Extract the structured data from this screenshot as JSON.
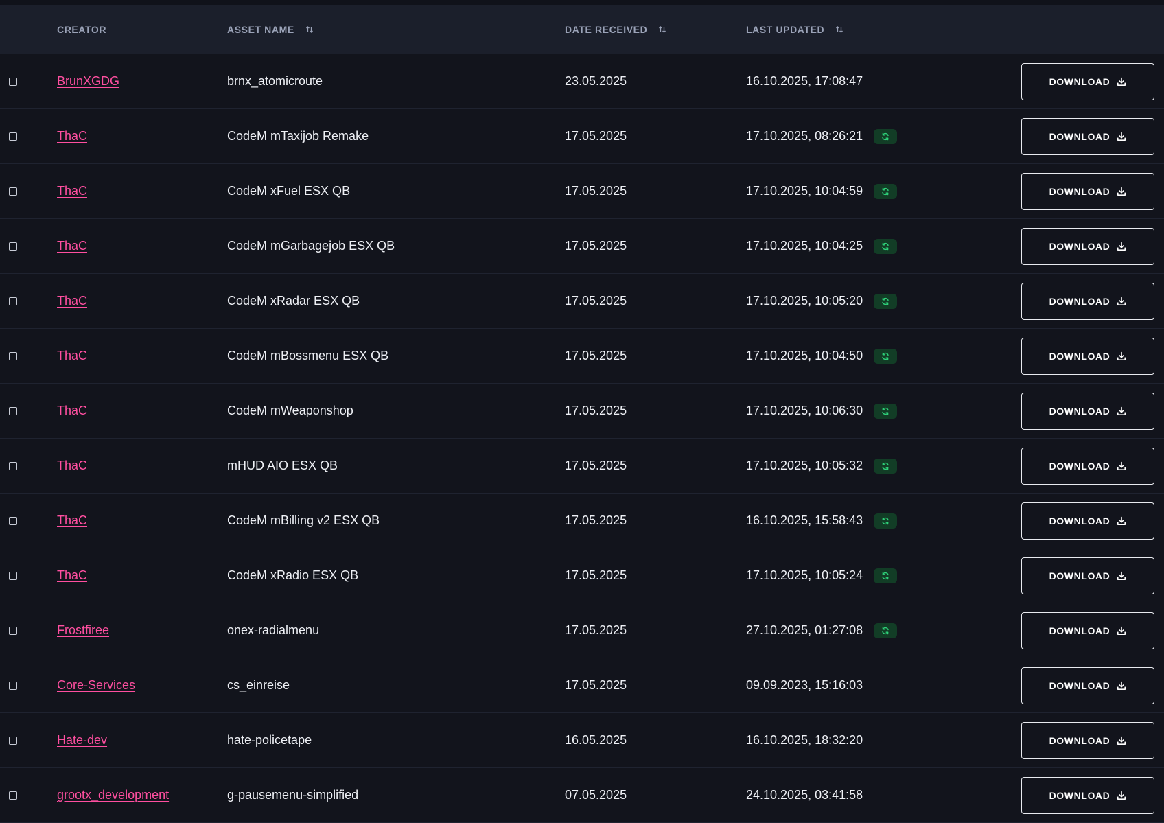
{
  "table": {
    "columns": {
      "creator": "CREATOR",
      "asset_name": "ASSET NAME",
      "date_received": "DATE RECEIVED",
      "last_updated": "LAST UPDATED"
    },
    "sortable_columns": [
      "asset_name",
      "date_received",
      "last_updated"
    ],
    "download_label": "DOWNLOAD",
    "colors": {
      "creator_link": "#ff4fa0",
      "update_badge_bg": "#123d26",
      "update_icon": "#2fd27a",
      "header_bg": "#1b1f2b",
      "row_bg": "#12141c"
    },
    "rows": [
      {
        "creator": "BrunXGDG",
        "asset": "brnx_atomicroute",
        "date": "23.05.2025",
        "updated": "16.10.2025, 17:08:47",
        "updated_icon": false
      },
      {
        "creator": "ThaC",
        "asset": "CodeM mTaxijob Remake",
        "date": "17.05.2025",
        "updated": "17.10.2025, 08:26:21",
        "updated_icon": true
      },
      {
        "creator": "ThaC",
        "asset": "CodeM xFuel ESX QB",
        "date": "17.05.2025",
        "updated": "17.10.2025, 10:04:59",
        "updated_icon": true
      },
      {
        "creator": "ThaC",
        "asset": "CodeM mGarbagejob ESX QB",
        "date": "17.05.2025",
        "updated": "17.10.2025, 10:04:25",
        "updated_icon": true
      },
      {
        "creator": "ThaC",
        "asset": "CodeM xRadar ESX QB",
        "date": "17.05.2025",
        "updated": "17.10.2025, 10:05:20",
        "updated_icon": true
      },
      {
        "creator": "ThaC",
        "asset": "CodeM mBossmenu ESX QB",
        "date": "17.05.2025",
        "updated": "17.10.2025, 10:04:50",
        "updated_icon": true
      },
      {
        "creator": "ThaC",
        "asset": "CodeM mWeaponshop",
        "date": "17.05.2025",
        "updated": "17.10.2025, 10:06:30",
        "updated_icon": true
      },
      {
        "creator": "ThaC",
        "asset": "mHUD AIO ESX QB",
        "date": "17.05.2025",
        "updated": "17.10.2025, 10:05:32",
        "updated_icon": true
      },
      {
        "creator": "ThaC",
        "asset": "CodeM mBilling v2 ESX QB",
        "date": "17.05.2025",
        "updated": "16.10.2025, 15:58:43",
        "updated_icon": true
      },
      {
        "creator": "ThaC",
        "asset": "CodeM xRadio ESX QB",
        "date": "17.05.2025",
        "updated": "17.10.2025, 10:05:24",
        "updated_icon": true
      },
      {
        "creator": "Frostfiree",
        "asset": "onex-radialmenu",
        "date": "17.05.2025",
        "updated": "27.10.2025, 01:27:08",
        "updated_icon": true
      },
      {
        "creator": "Core-Services",
        "asset": "cs_einreise",
        "date": "17.05.2025",
        "updated": "09.09.2023, 15:16:03",
        "updated_icon": false
      },
      {
        "creator": "Hate-dev",
        "asset": "hate-policetape",
        "date": "16.05.2025",
        "updated": "16.10.2025, 18:32:20",
        "updated_icon": false
      },
      {
        "creator": "grootx_development",
        "asset": "g-pausemenu-simplified",
        "date": "07.05.2025",
        "updated": "24.10.2025, 03:41:58",
        "updated_icon": false
      }
    ]
  }
}
